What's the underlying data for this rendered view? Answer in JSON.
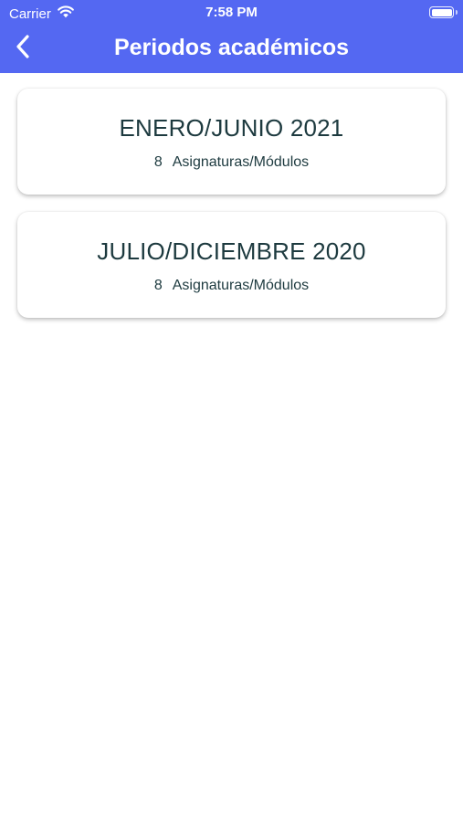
{
  "status_bar": {
    "carrier": "Carrier",
    "time": "7:58 PM"
  },
  "nav": {
    "title": "Periodos académicos",
    "back_icon": "chevron-left-icon"
  },
  "periods": [
    {
      "name": "ENERO/JUNIO 2021",
      "count": "8",
      "unit": "Asignaturas/Módulos"
    },
    {
      "name": "JULIO/DICIEMBRE 2020",
      "count": "8",
      "unit": "Asignaturas/Módulos"
    }
  ],
  "colors": {
    "header": "#5468f2",
    "card_text": "#1d3a3f",
    "background": "#ffffff"
  }
}
